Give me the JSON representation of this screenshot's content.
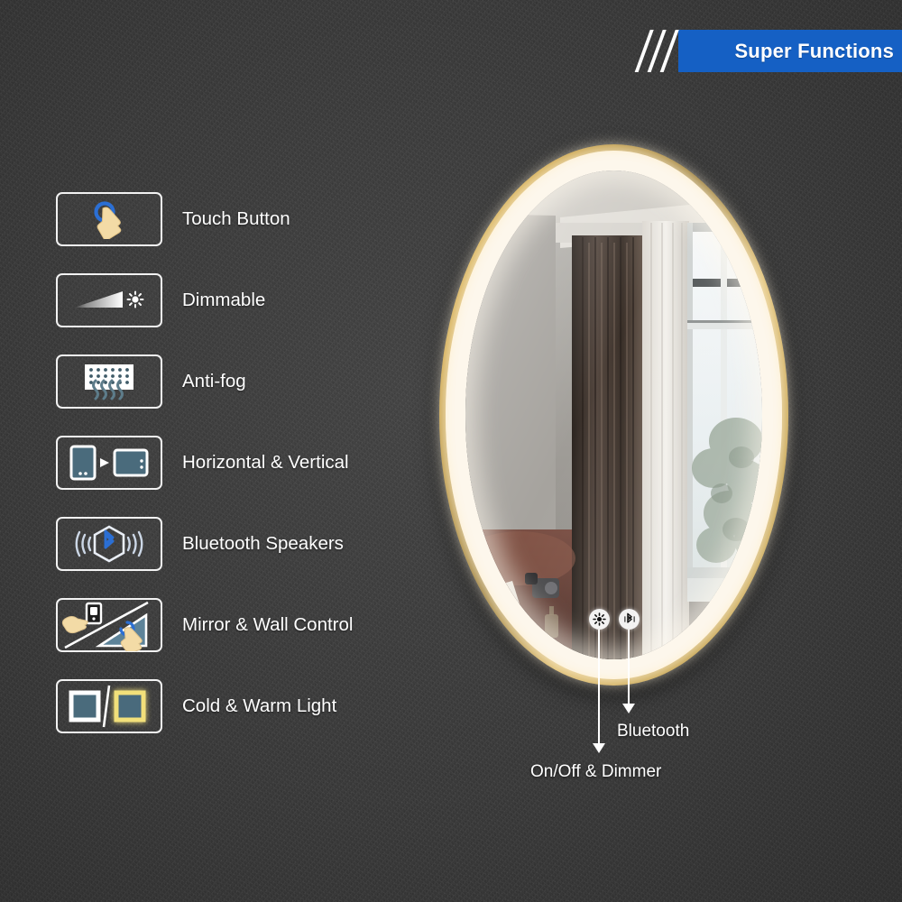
{
  "banner": {
    "title": "Super Functions",
    "background_color": "#1560c4",
    "text_color": "#ffffff",
    "stripe_count": 3
  },
  "background": {
    "color": "#3a3a3a",
    "description": "dark-gray-textured-wall"
  },
  "features": [
    {
      "id": "touch-button",
      "label": "Touch Button",
      "icon": "touch-button-icon"
    },
    {
      "id": "dimmable",
      "label": "Dimmable",
      "icon": "dimmer-gradient-icon"
    },
    {
      "id": "anti-fog",
      "label": "Anti-fog",
      "icon": "anti-fog-heater-icon"
    },
    {
      "id": "orientation",
      "label": "Horizontal & Vertical",
      "icon": "horizontal-vertical-icon"
    },
    {
      "id": "bluetooth",
      "label": "Bluetooth Speakers",
      "icon": "bluetooth-speaker-icon"
    },
    {
      "id": "mirror-wall",
      "label": "Mirror & Wall Control",
      "icon": "mirror-wall-control-icon"
    },
    {
      "id": "cold-warm",
      "label": "Cold & Warm Light",
      "icon": "cold-warm-light-icon"
    }
  ],
  "product": {
    "name": "led-oval-mirror",
    "frame_color": "#c99c35",
    "frame_finish": "gold",
    "led_glow_color": "#fdf7ec",
    "shape": "oval-pill",
    "reflection": "bedroom-with-window-and-curtains"
  },
  "touch_controls": [
    {
      "id": "dimmer",
      "icon": "brightness-sun-icon",
      "callout": "On/Off & Dimmer"
    },
    {
      "id": "bluetooth",
      "icon": "bluetooth-icon",
      "callout": "Bluetooth"
    }
  ],
  "callouts": {
    "dimmer": "On/Off & Dimmer",
    "bluetooth": "Bluetooth"
  },
  "icon_colors": {
    "blue": "#2b6fd4",
    "hand": "#f3dba6",
    "device_slate": "#4a6b7c",
    "warm_yellow": "#f2e07a",
    "white": "#ffffff"
  }
}
